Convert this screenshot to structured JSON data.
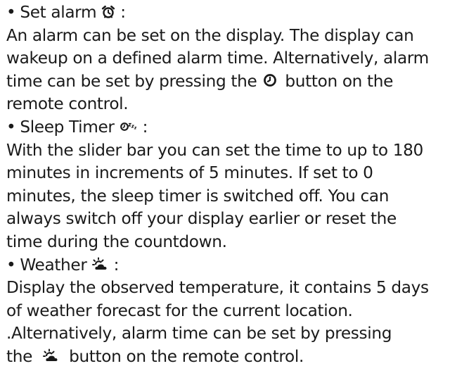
{
  "sections": [
    {
      "bullet": "•",
      "heading": "Set alarm",
      "icon": "alarm-clock-icon",
      "suffix": ":",
      "lines": [
        "An alarm can be set on the display. The display can",
        "wakeup on a defined alarm time. Alternatively, alarm"
      ],
      "inline_line": {
        "before": "time can be set by pressing the",
        "icon": "clock-icon",
        "after": "button on the"
      },
      "lines_after": [
        "remote control."
      ]
    },
    {
      "bullet": "•",
      "heading": "Sleep Timer",
      "icon": "sleep-timer-icon",
      "suffix": ":",
      "lines": [
        "With the slider bar you can set the time to up to 180",
        "minutes in increments of 5 minutes. If set to 0",
        "minutes, the sleep timer is switched off. You can",
        "always switch off your display earlier or reset the",
        "time during the countdown."
      ]
    },
    {
      "bullet": "•",
      "heading": "Weather",
      "icon": "weather-icon",
      "suffix": ":",
      "lines": [
        "Display the observed temperature, it contains 5 days",
        "of weather forecast for the current location.",
        ".Alternatively, alarm time can be set by pressing"
      ],
      "inline_line": {
        "before": "the",
        "icon": "weather-icon",
        "after": "button on the remote control."
      }
    }
  ]
}
